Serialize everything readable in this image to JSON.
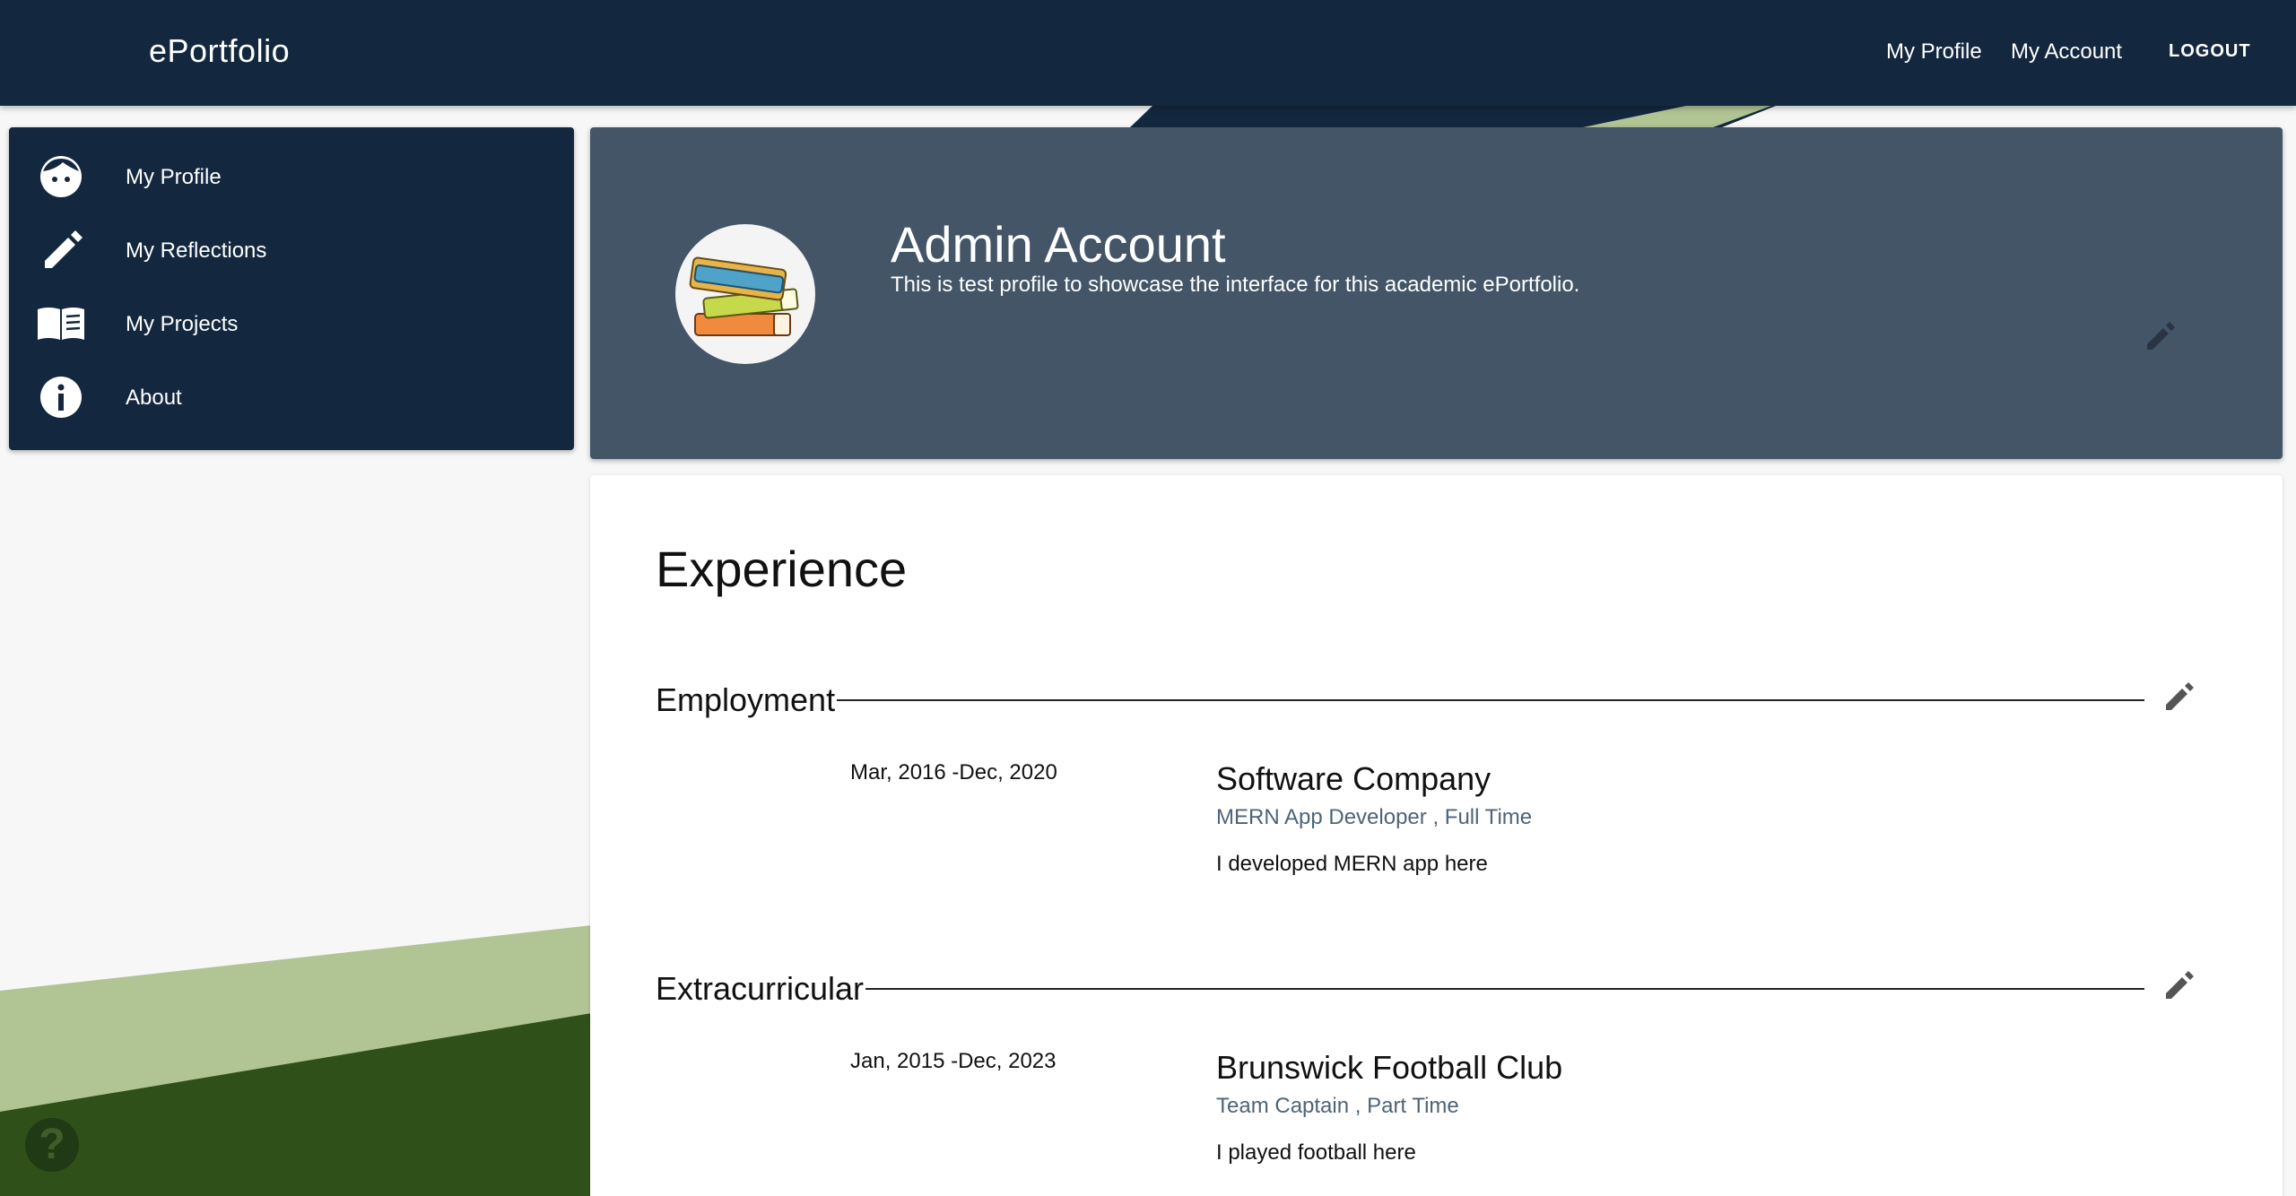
{
  "header": {
    "brand": "ePortfolio",
    "nav": {
      "my_profile": "My Profile",
      "my_account": "My Account",
      "logout": "LOGOUT"
    }
  },
  "sidebar": {
    "items": [
      {
        "label": "My Profile",
        "icon": "face-icon"
      },
      {
        "label": "My Reflections",
        "icon": "pencil-icon"
      },
      {
        "label": "My Projects",
        "icon": "book-icon"
      },
      {
        "label": "About",
        "icon": "info-icon"
      }
    ]
  },
  "profile": {
    "name": "Admin Account",
    "description": "This is test profile to showcase the interface for this academic ePortfolio.",
    "avatar_icon": "books-avatar"
  },
  "experience": {
    "title": "Experience",
    "sections": [
      {
        "heading": "Employment",
        "entries": [
          {
            "dates": "Mar, 2016 -Dec, 2020",
            "organization": "Software Company",
            "role": "MERN App Developer , Full Time",
            "description": "I developed MERN app here"
          }
        ]
      },
      {
        "heading": "Extracurricular",
        "entries": [
          {
            "dates": "Jan, 2015 -Dec, 2023",
            "organization": "Brunswick Football Club",
            "role": "Team Captain , Part Time",
            "description": "I played football here"
          }
        ]
      }
    ]
  },
  "help": {
    "glyph": "?"
  },
  "colors": {
    "navy": "#13283f",
    "slate": "#435567",
    "light_green": "#b1c494",
    "dark_green": "#2f5119",
    "role_text": "#4f6478"
  }
}
